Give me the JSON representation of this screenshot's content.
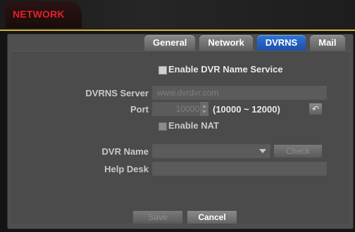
{
  "window": {
    "title": "NETWORK"
  },
  "tabs": [
    {
      "label": "General",
      "active": false
    },
    {
      "label": "Network",
      "active": false
    },
    {
      "label": "DVRNS",
      "active": true
    },
    {
      "label": "Mail",
      "active": false
    }
  ],
  "dvrns": {
    "enable_label": "Enable DVR Name Service",
    "server_label": "DVRNS Server",
    "server_value": "www.dvrdvr.com",
    "port_label": "Port",
    "port_value": "10000",
    "port_range": "(10000 ~ 12000)",
    "enable_nat_label": "Enable NAT",
    "dvr_name_label": "DVR Name",
    "dvr_name_value": "",
    "dvr_name_dropdown_text": "",
    "check_label": "Check",
    "help_desk_label": "Help Desk",
    "help_desk_value": ""
  },
  "footer": {
    "save_label": "Save",
    "cancel_label": "Cancel"
  },
  "icons": {
    "reset_icon": "↶"
  },
  "colors": {
    "title_red": "#e4202a",
    "active_tab_blue": "#2f73d9",
    "panel_bg": "#4f4f4f"
  }
}
